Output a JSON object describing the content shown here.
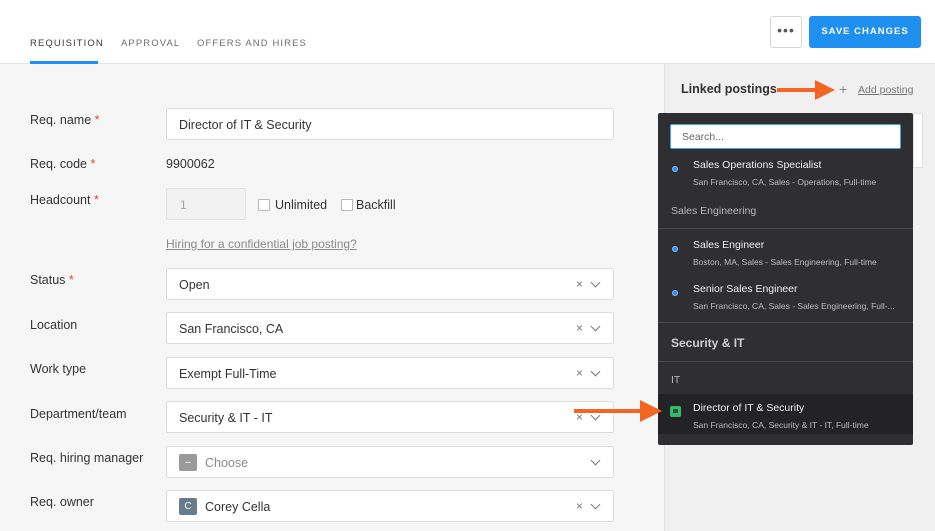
{
  "header": {
    "tabs": [
      {
        "label": "REQUISITION"
      },
      {
        "label": "APPROVAL"
      },
      {
        "label": "OFFERS AND HIRES"
      }
    ],
    "more_label": "•••",
    "save_label": "SAVE CHANGES"
  },
  "form": {
    "req_name": {
      "label": "Req. name",
      "required": "*",
      "value": "Director of IT & Security"
    },
    "req_code": {
      "label": "Req. code",
      "required": "*",
      "value": "9900062"
    },
    "headcount": {
      "label": "Headcount",
      "required": "*",
      "placeholder": "1",
      "unlimited_label": "Unlimited",
      "backfill_label": "Backfill"
    },
    "confidential_link": "Hiring for a confidential job posting?",
    "status": {
      "label": "Status",
      "required": "*",
      "value": "Open"
    },
    "location": {
      "label": "Location",
      "value": "San Francisco, CA"
    },
    "work_type": {
      "label": "Work type",
      "value": "Exempt Full-Time"
    },
    "department": {
      "label": "Department/team",
      "value": "Security & IT - IT"
    },
    "hiring_manager": {
      "label": "Req. hiring manager",
      "value": "Choose",
      "avatar": "–"
    },
    "owner": {
      "label": "Req. owner",
      "value": "Corey Cella",
      "avatar": "C"
    },
    "clear_icon": "×"
  },
  "linked_postings": {
    "title": "Linked postings",
    "add_icon": "+",
    "add_label": "Add posting",
    "search_placeholder": "Search...",
    "items": [
      {
        "title": "Sales Operations Specialist",
        "sub": "San Francisco, CA, Sales - Operations, Full-time"
      },
      {
        "group": "Sales Engineering"
      },
      {
        "title": "Sales Engineer",
        "sub": "Boston, MA, Sales - Sales Engineering, Full-time"
      },
      {
        "title": "Senior Sales Engineer",
        "sub": "San Francisco, CA, Sales - Sales Engineering, Full-..."
      },
      {
        "group": "Security & IT"
      },
      {
        "group": "IT"
      },
      {
        "title": "Director of IT & Security",
        "sub": "San Francisco, CA, Security & IT - IT, Full-time"
      }
    ]
  },
  "colors": {
    "accent": "#1f8ff0",
    "required": "#e0463f",
    "annotation_arrow": "#f26522",
    "selected_check": "#38b86a"
  }
}
